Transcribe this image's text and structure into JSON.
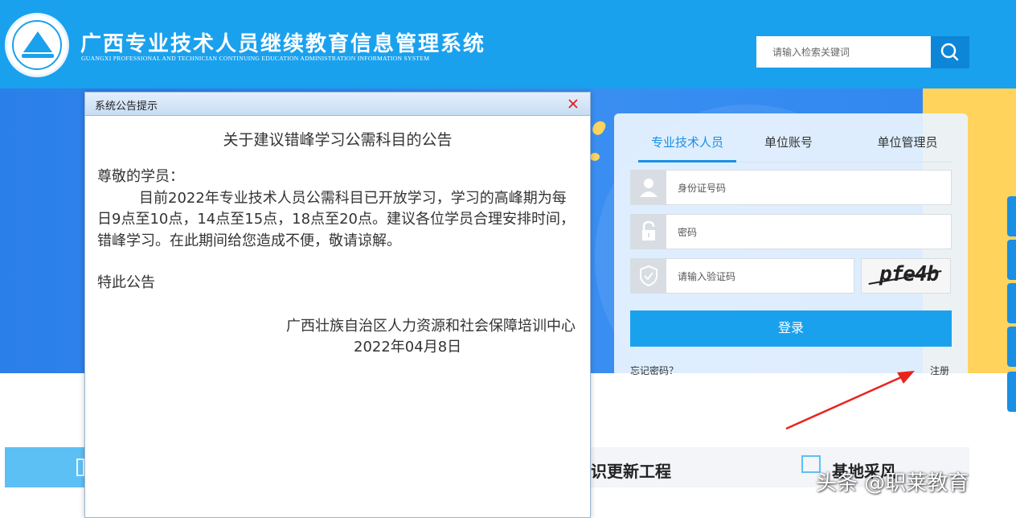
{
  "header": {
    "title": "广西专业技术人员继续教育信息管理系统",
    "subtitle": "GUANGXI PROFESSIONAL AND TECHNICIAN CONTINUING EDUCATION ADMINISTRATION INFORMATION SYSTEM",
    "search_placeholder": "请输入检索关键词",
    "search_icon": "search-icon"
  },
  "login": {
    "tabs": [
      {
        "label": "专业技术人员",
        "active": true
      },
      {
        "label": "单位账号",
        "active": false
      },
      {
        "label": "单位管理员",
        "active": false
      }
    ],
    "id_placeholder": "身份证号码",
    "password_placeholder": "密码",
    "captcha_placeholder": "请输入验证码",
    "captcha_text": "pfe4b",
    "login_label": "登录",
    "forgot_label": "忘记密码？",
    "register_label": "注册"
  },
  "bottom": {
    "title_1": "识更新工程",
    "title_2": "基地采风"
  },
  "watermark": "头条 @职莱教育",
  "modal": {
    "title": "系统公告提示",
    "close_icon": "close-icon",
    "notice_title": "关于建议错峰学习公需科目的公告",
    "greeting": "尊敬的学员：",
    "body": "目前2022年专业技术人员公需科目已开放学习，学习的高峰期为每日9点至10点，14点至15点，18点至20点。建议各位学员合理安排时间，错峰学习。在此期间给您造成不便，敬请谅解。",
    "closing": "特此公告",
    "org": "广西壮族自治区人力资源和社会保障培训中心",
    "date": "2022年04月8日"
  },
  "colors": {
    "header_bg": "#1aa1ee",
    "accent": "#1a8fe3",
    "banner_yellow": "#ffd35c",
    "arrow_red": "#e8241c"
  }
}
